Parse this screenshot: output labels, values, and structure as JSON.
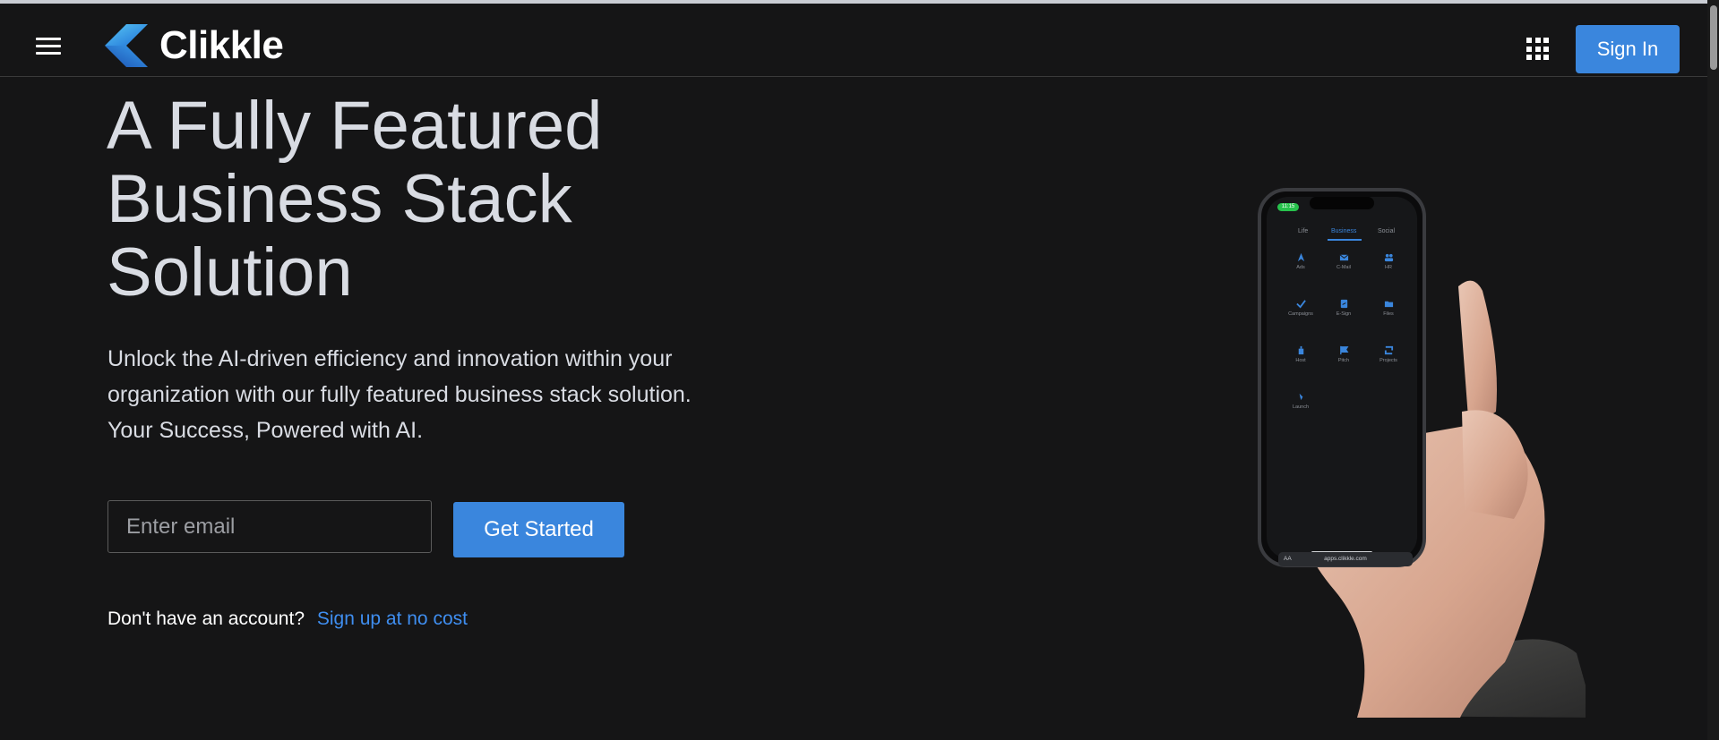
{
  "header": {
    "menu_icon": "hamburger-menu-icon",
    "brand_name": "Clikkle",
    "apps_icon": "apps-grid-icon",
    "signin_label": "Sign In"
  },
  "hero": {
    "title_lines": [
      "A Fully Featured",
      "Business Stack",
      "Solution"
    ],
    "description_lines": [
      "Unlock the AI-driven efficiency and innovation within your",
      "organization with our fully featured business stack solution.",
      "Your Success, Powered with AI."
    ],
    "email_placeholder": "Enter email",
    "email_value": "",
    "cta_label": "Get Started",
    "signup_prompt": "Don't have an account?",
    "signup_link": "Sign up at no cost"
  },
  "phone": {
    "status_time": "11:15",
    "tabs": [
      "Life",
      "Business",
      "Social"
    ],
    "active_tab": "Business",
    "apps": [
      "Ads",
      "C-Mail",
      "HR",
      "Campaigns",
      "E-Sign",
      "Files",
      "Host",
      "Pitch",
      "Projects",
      "Launch"
    ],
    "url_bar": "apps.clikkle.com",
    "text_size_button": "AA"
  },
  "colors": {
    "background": "#151516",
    "accent": "#3a86dd",
    "link": "#3f8ef0",
    "heading_text": "#d9dce3"
  }
}
